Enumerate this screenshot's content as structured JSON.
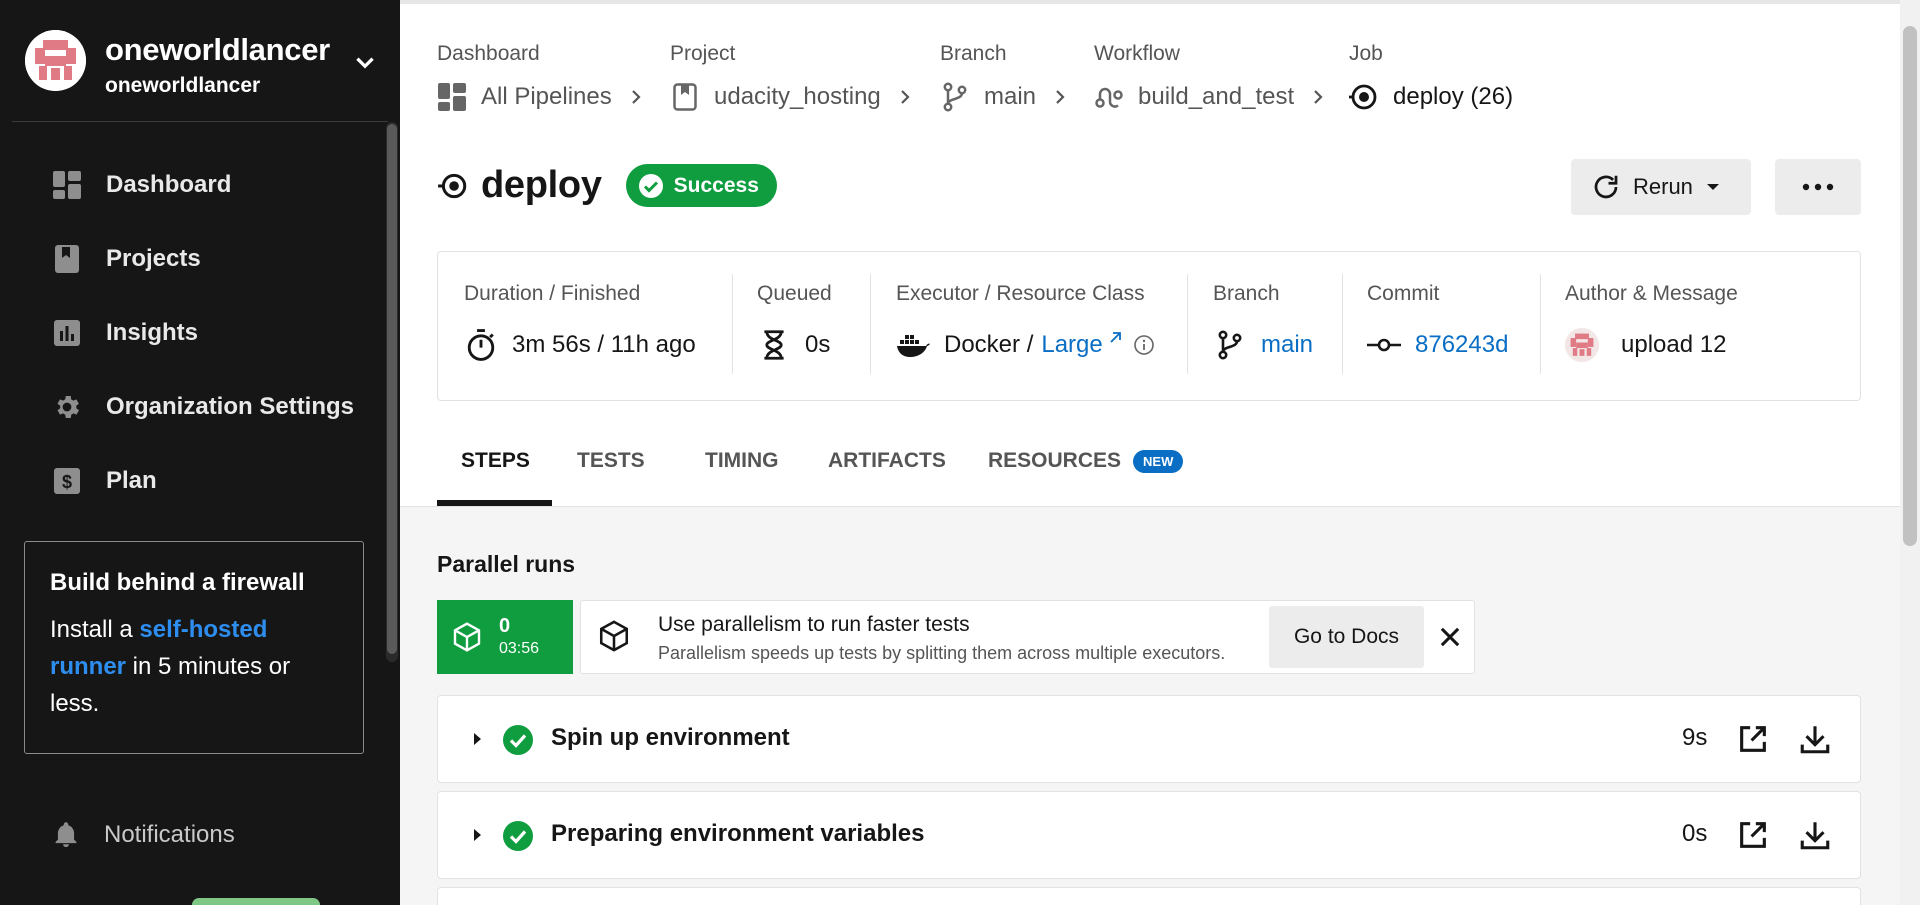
{
  "org": {
    "name": "oneworldlancer",
    "username": "oneworldlancer",
    "avatar_icon": "identicon-avatar",
    "menu_icon": "chevron-down-icon"
  },
  "sidebar": {
    "items": [
      {
        "label": "Dashboard",
        "icon": "dashboard-icon"
      },
      {
        "label": "Projects",
        "icon": "bookmark-icon"
      },
      {
        "label": "Insights",
        "icon": "bar-chart-icon"
      },
      {
        "label": "Organization Settings",
        "icon": "gear-icon"
      },
      {
        "label": "Plan",
        "icon": "dollar-icon"
      }
    ],
    "promo": {
      "title": "Build behind a firewall",
      "pre": "Install a ",
      "link": "self-hosted runner",
      "post": " in 5 minutes or less."
    },
    "notifications": {
      "label": "Notifications",
      "icon": "bell-icon"
    }
  },
  "breadcrumbs": [
    {
      "caption": "Dashboard",
      "value": "All Pipelines",
      "icon": "dashboard-icon"
    },
    {
      "caption": "Project",
      "value": "udacity_hosting",
      "icon": "bookmark-icon"
    },
    {
      "caption": "Branch",
      "value": "main",
      "icon": "branch-icon"
    },
    {
      "caption": "Workflow",
      "value": "build_and_test",
      "icon": "workflow-icon"
    },
    {
      "caption": "Job",
      "value": "deploy (26)",
      "icon": "job-icon"
    }
  ],
  "job": {
    "title": "deploy",
    "status": "Success",
    "status_color": "#0f9d3f"
  },
  "actions": {
    "rerun": "Rerun",
    "more": "more-icon"
  },
  "summary": {
    "duration": {
      "caption": "Duration / Finished",
      "value": "3m 56s / 11h ago"
    },
    "queued": {
      "caption": "Queued",
      "value": "0s"
    },
    "executor": {
      "caption": "Executor / Resource Class",
      "executor": "Docker /",
      "resource_class": "Large"
    },
    "branch": {
      "caption": "Branch",
      "value": "main"
    },
    "commit": {
      "caption": "Commit",
      "value": "876243d"
    },
    "author": {
      "caption": "Author & Message",
      "message": "upload 12"
    }
  },
  "tabs": [
    {
      "label": "STEPS",
      "active": true
    },
    {
      "label": "TESTS"
    },
    {
      "label": "TIMING"
    },
    {
      "label": "ARTIFACTS"
    },
    {
      "label": "RESOURCES",
      "badge": "NEW"
    }
  ],
  "parallel": {
    "title": "Parallel runs",
    "run": {
      "index": "0",
      "time": "03:56"
    },
    "tip": {
      "title": "Use parallelism to run faster tests",
      "subtitle": "Parallelism speeds up tests by splitting them across multiple executors.",
      "button": "Go to Docs"
    }
  },
  "steps": [
    {
      "name": "Spin up environment",
      "duration": "9s"
    },
    {
      "name": "Preparing environment variables",
      "duration": "0s"
    }
  ],
  "colors": {
    "accent_link": "#0a6ec4",
    "success": "#0f9d3f",
    "sidebar_bg": "#161616"
  }
}
